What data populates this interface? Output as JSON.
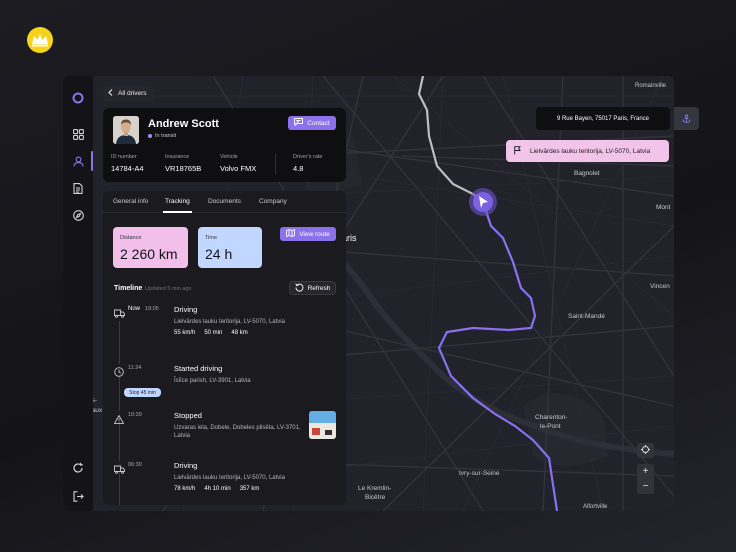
{
  "brand": {
    "logo_icon": "crown-icon",
    "color": "#f6d31b"
  },
  "rail": {
    "top_icon": "ring-logo-icon",
    "items": [
      {
        "name": "grid-icon"
      },
      {
        "name": "user-icon",
        "active": true
      },
      {
        "name": "document-icon"
      },
      {
        "name": "compass-icon"
      }
    ],
    "bottom_items": [
      {
        "name": "refresh-icon"
      },
      {
        "name": "logout-icon"
      }
    ]
  },
  "back": {
    "label": "All drivers"
  },
  "driver": {
    "name": "Andrew Scott",
    "status": "In transit",
    "contact_label": "Contact",
    "facts": [
      {
        "label": "ID number",
        "value": "14784-A4"
      },
      {
        "label": "Insurance",
        "value": "VR18765B"
      },
      {
        "label": "Vehicle",
        "value": "Volvo FMX"
      },
      {
        "label": "Driver's rate",
        "value": "4.8"
      }
    ]
  },
  "tabs": [
    "General info",
    "Tracking",
    "Documents",
    "Company"
  ],
  "active_tab": "Tracking",
  "stats": {
    "distance": {
      "label": "Distance",
      "value": "2 260 km",
      "color": "#f2bfea"
    },
    "time": {
      "label": "Time",
      "value": "24 h",
      "color": "#c2d7ff"
    }
  },
  "view_route_label": "View route",
  "timeline": {
    "title": "Timeline",
    "updated": "Updated 5 min ago",
    "refresh_label": "Refresh",
    "events": [
      {
        "icon": "truck-icon",
        "now": "Now",
        "time": "18:05",
        "title": "Driving",
        "address": "Lielvārdes lauku teritorija, LV-5070, Latvia",
        "metrics": [
          "55 km/h",
          "50 min",
          "48 km"
        ]
      },
      {
        "icon": "clock-icon",
        "time": "11:24",
        "title": "Started driving",
        "address": "Īslīce parish, LV-3901, Latvia",
        "badge": "Stop 45 min"
      },
      {
        "icon": "warning-icon",
        "time": "10:39",
        "title": "Stopped",
        "address": "Uzvaras iela, Dobele, Dobeles pilsēta, LV-3701, Latvia"
      },
      {
        "icon": "truck-icon",
        "time": "06:30",
        "title": "Driving",
        "address": "Lielvārdes lauku teritorija, LV-5070, Latvia",
        "metrics": [
          "78 km/h",
          "4h 10 min",
          "357 km"
        ]
      }
    ]
  },
  "map": {
    "address": "9 Rue Bayen, 75017 Paris, France",
    "destination": "Lielvārdes lauku teritorija, LV-5070, Latvia",
    "route_color": "#8a70f0",
    "labels": {
      "paris": "Paris",
      "romainville": "Romainville",
      "bagnolet": "Bagnolet",
      "montreuil": "Mont",
      "saint_mande": "Saint-Mandé",
      "vincennes": "Vincen",
      "charenton": "Charenton-\nle-Pont",
      "ivry": "Ivry-sur-Seine",
      "kremlin": "Le Kremlin-\nBicêtre",
      "alfortville": "Alfortville",
      "issy": "ns-",
      "issy2": "eaux"
    },
    "controls": {
      "locate": "crosshair-icon",
      "zoom_in": "+",
      "zoom_out": "−"
    }
  }
}
